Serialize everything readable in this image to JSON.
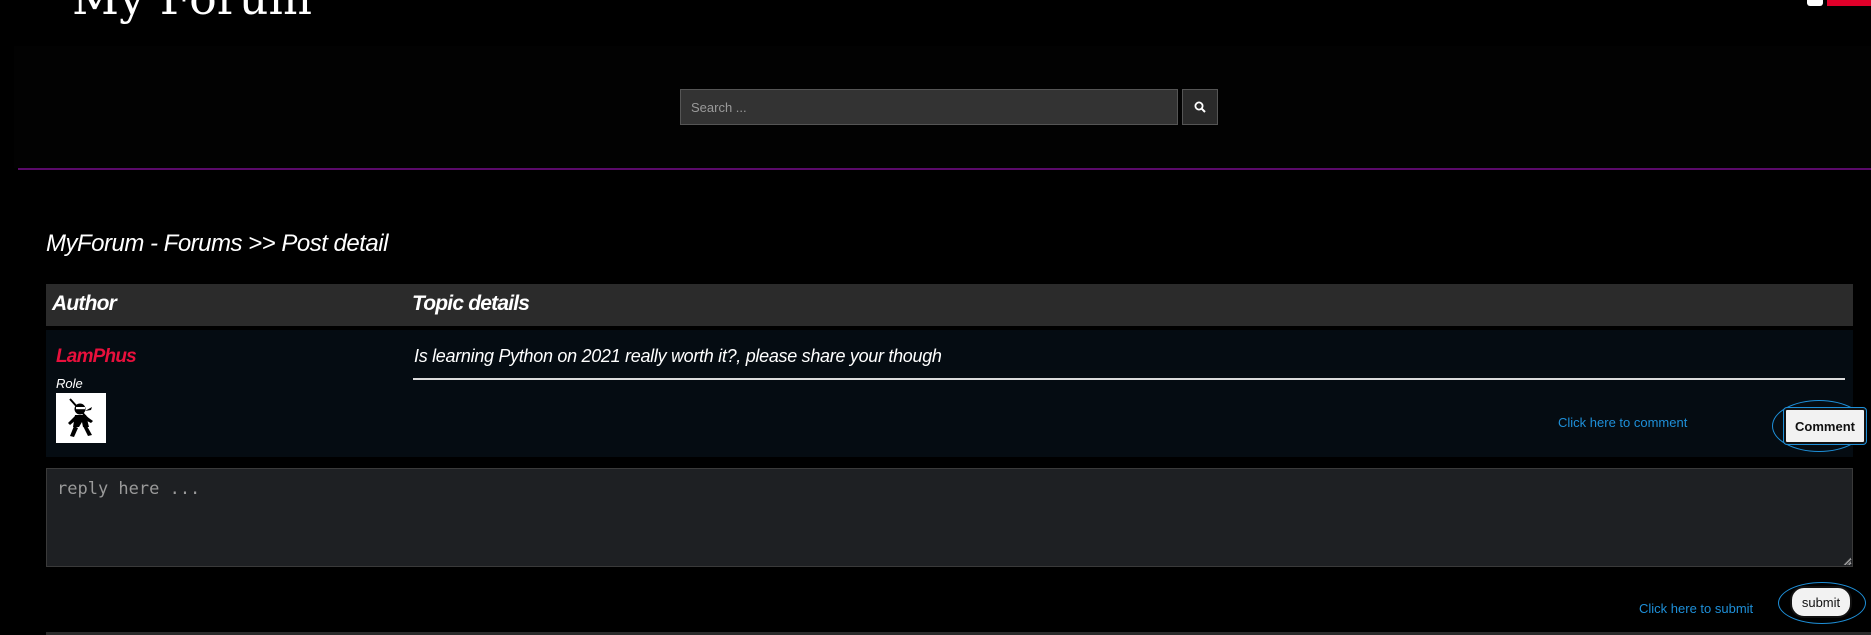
{
  "header": {
    "site_title": "My Forum",
    "search_placeholder": "Search ..."
  },
  "breadcrumb": "MyForum - Forums >> Post detail",
  "table": {
    "headers": [
      "Author",
      "Topic details"
    ],
    "post": {
      "author": "LamPhus",
      "role": "Role",
      "topic": "Is learning Python on 2021 really worth it?, please share your though",
      "comment_link": "Click here to comment",
      "comment_button": "Comment"
    }
  },
  "reply": {
    "placeholder": "reply here ...",
    "submit_link": "Click here to submit",
    "submit_button": "submit"
  },
  "colors": {
    "background": "#000000",
    "accent_line": "#5a0a6a",
    "author": "#e8103c",
    "link": "#1e8fd8"
  },
  "icons": [
    "menu-icon",
    "search-icon",
    "avatar-ninja-icon"
  ]
}
